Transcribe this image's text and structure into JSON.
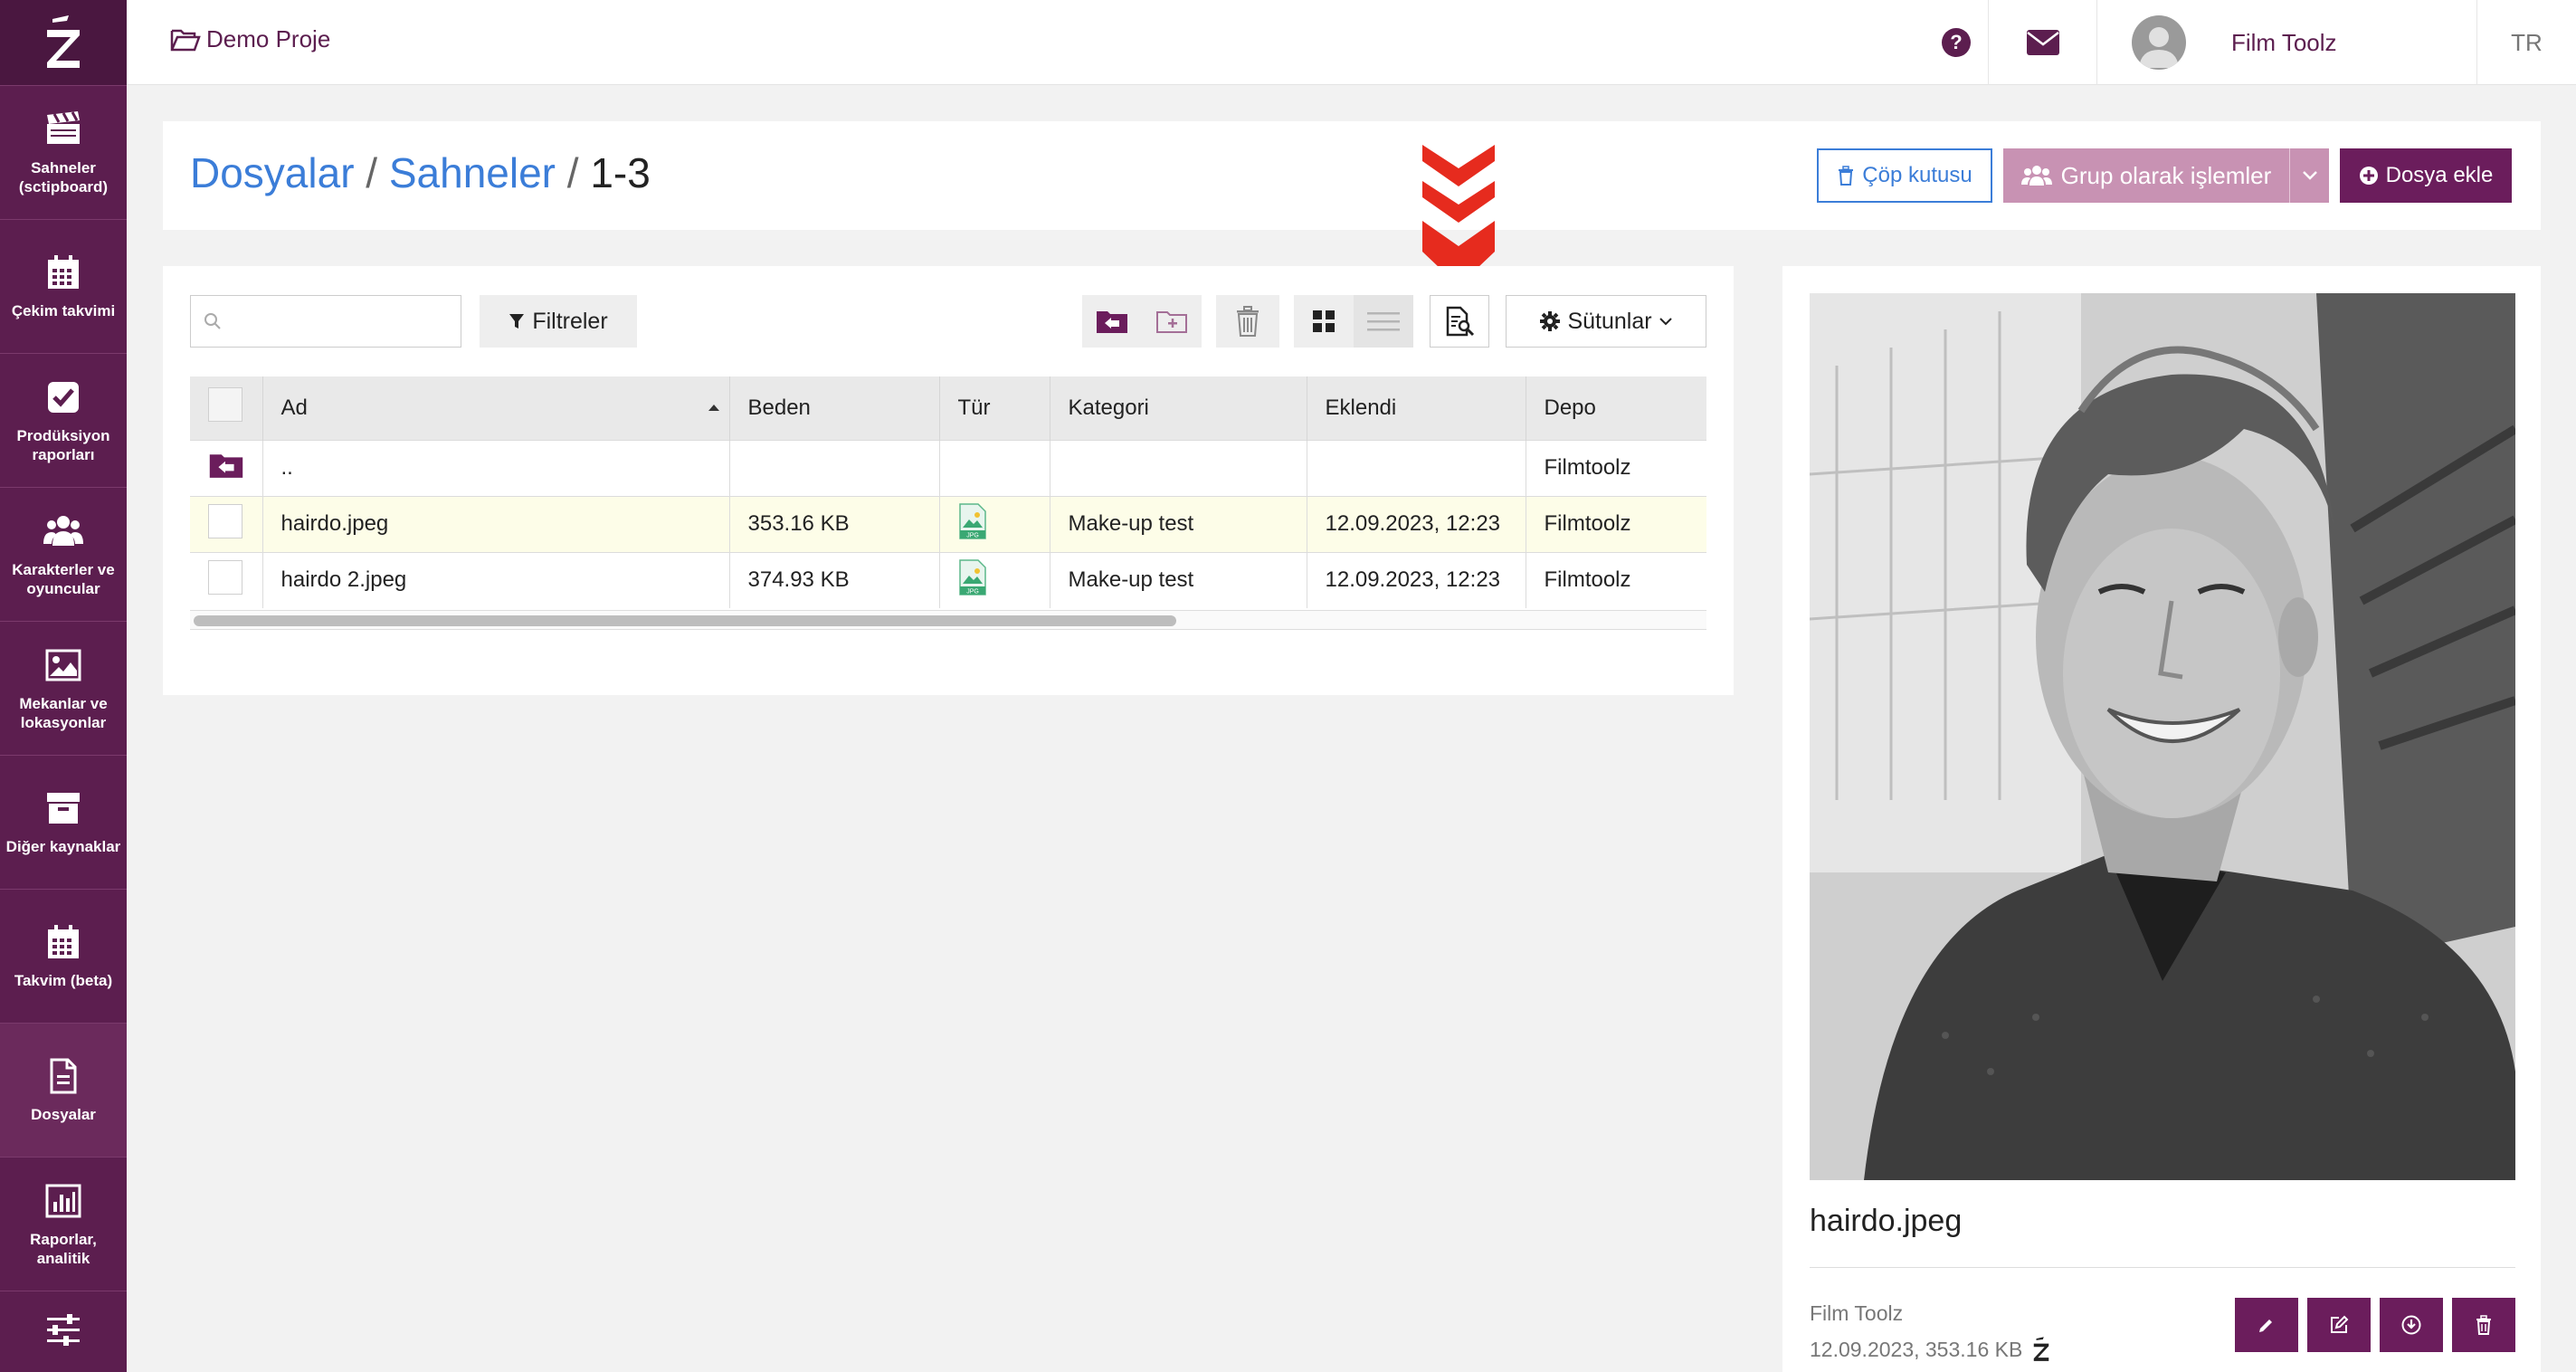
{
  "sidebar": {
    "items": [
      {
        "label": "Sahneler (sctipboard)",
        "icon": "clapperboard-icon"
      },
      {
        "label": "Çekim takvimi",
        "icon": "calendar-icon"
      },
      {
        "label": "Prodüksiyon raporları",
        "icon": "checkbox-icon"
      },
      {
        "label": "Karakterler ve oyuncular",
        "icon": "users-icon"
      },
      {
        "label": "Mekanlar ve lokasyonlar",
        "icon": "image-icon"
      },
      {
        "label": "Diğer kaynaklar",
        "icon": "archive-icon"
      },
      {
        "label": "Takvim (beta)",
        "icon": "calendar-icon"
      },
      {
        "label": "Dosyalar",
        "icon": "file-icon"
      },
      {
        "label": "Raporlar, analitik",
        "icon": "bar-chart-icon"
      },
      {
        "label": "",
        "icon": "sliders-icon"
      }
    ]
  },
  "topbar": {
    "project": "Demo Proje",
    "user": "Film Toolz",
    "lang": "TR"
  },
  "header": {
    "crumbs": [
      "Dosyalar",
      "Sahneler",
      "1-3"
    ],
    "trash_label": "Çöp kutusu",
    "group_label": "Grup olarak işlemler",
    "add_label": "Dosya ekle"
  },
  "toolbar": {
    "search_placeholder": "",
    "filter_label": "Filtreler",
    "columns_label": "Sütunlar"
  },
  "table": {
    "headers": [
      "Ad",
      "Beden",
      "Tür",
      "Kategori",
      "Eklendi",
      "Depo"
    ],
    "parent_row": {
      "name": "..",
      "depot": "Filmtoolz"
    },
    "rows": [
      {
        "name": "hairdo.jpeg",
        "size": "353.16 KB",
        "type": "JPG",
        "category": "Make-up test",
        "added": "12.09.2023, 12:23",
        "depot": "Filmtoolz"
      },
      {
        "name": "hairdo 2.jpeg",
        "size": "374.93 KB",
        "type": "JPG",
        "category": "Make-up test",
        "added": "12.09.2023, 12:23",
        "depot": "Filmtoolz"
      }
    ]
  },
  "preview": {
    "file_name": "hairdo.jpeg",
    "owner": "Film Toolz",
    "meta": "12.09.2023, 353.16 KB"
  },
  "colors": {
    "brand": "#5c1e4f",
    "link": "#3b7dd8",
    "marker": "#e62b1e"
  }
}
